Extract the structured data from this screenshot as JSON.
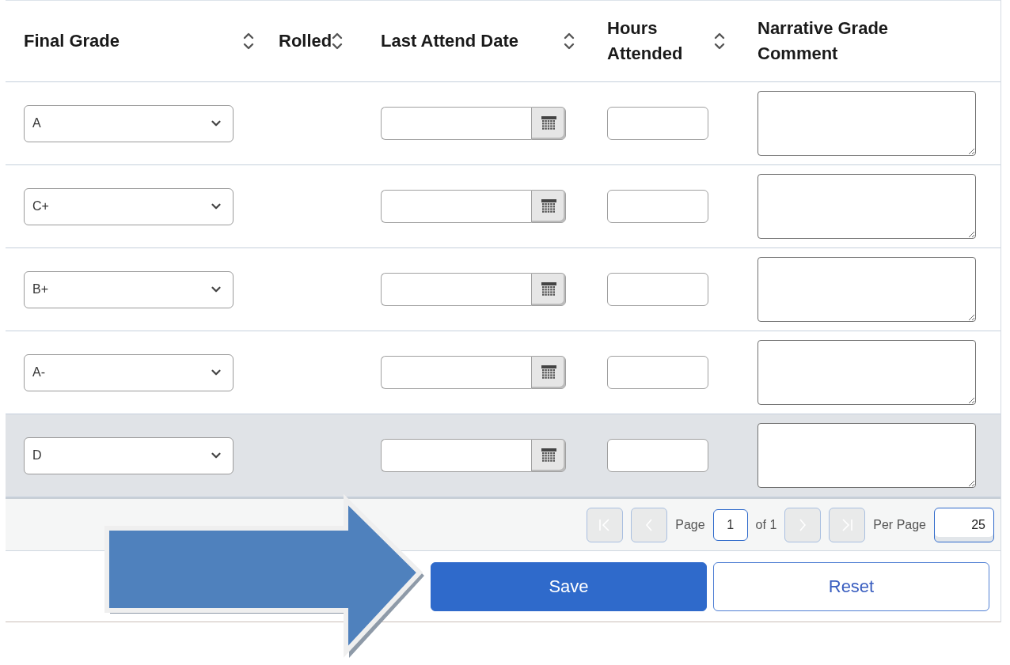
{
  "columns": [
    {
      "label": "Final Grade",
      "sortable": true
    },
    {
      "label": "Rolled",
      "sortable": true
    },
    {
      "label": "Last Attend Date",
      "sortable": true
    },
    {
      "label": "Hours Attended",
      "sortable": true
    },
    {
      "label": "Narrative Grade Comment",
      "sortable": false
    }
  ],
  "rows": [
    {
      "final_grade": "A",
      "highlighted": false
    },
    {
      "final_grade": "C+",
      "highlighted": false
    },
    {
      "final_grade": "B+",
      "highlighted": false
    },
    {
      "final_grade": "A-",
      "highlighted": false
    },
    {
      "final_grade": "D",
      "highlighted": true
    }
  ],
  "pager": {
    "nav_before": [
      {
        "kind": "first",
        "disabled": true
      },
      {
        "kind": "prev",
        "disabled": true
      }
    ],
    "page_label": "Page",
    "page_value": "1",
    "of_label": "of 1",
    "nav_after": [
      {
        "kind": "next",
        "disabled": true
      },
      {
        "kind": "last",
        "disabled": true
      }
    ],
    "per_page_label": "Per Page",
    "per_page_value": "25"
  },
  "buttons": [
    {
      "label": "Save",
      "kind": "primary"
    },
    {
      "label": "Reset",
      "kind": "secondary"
    }
  ],
  "annotation": {
    "kind": "arrow"
  }
}
